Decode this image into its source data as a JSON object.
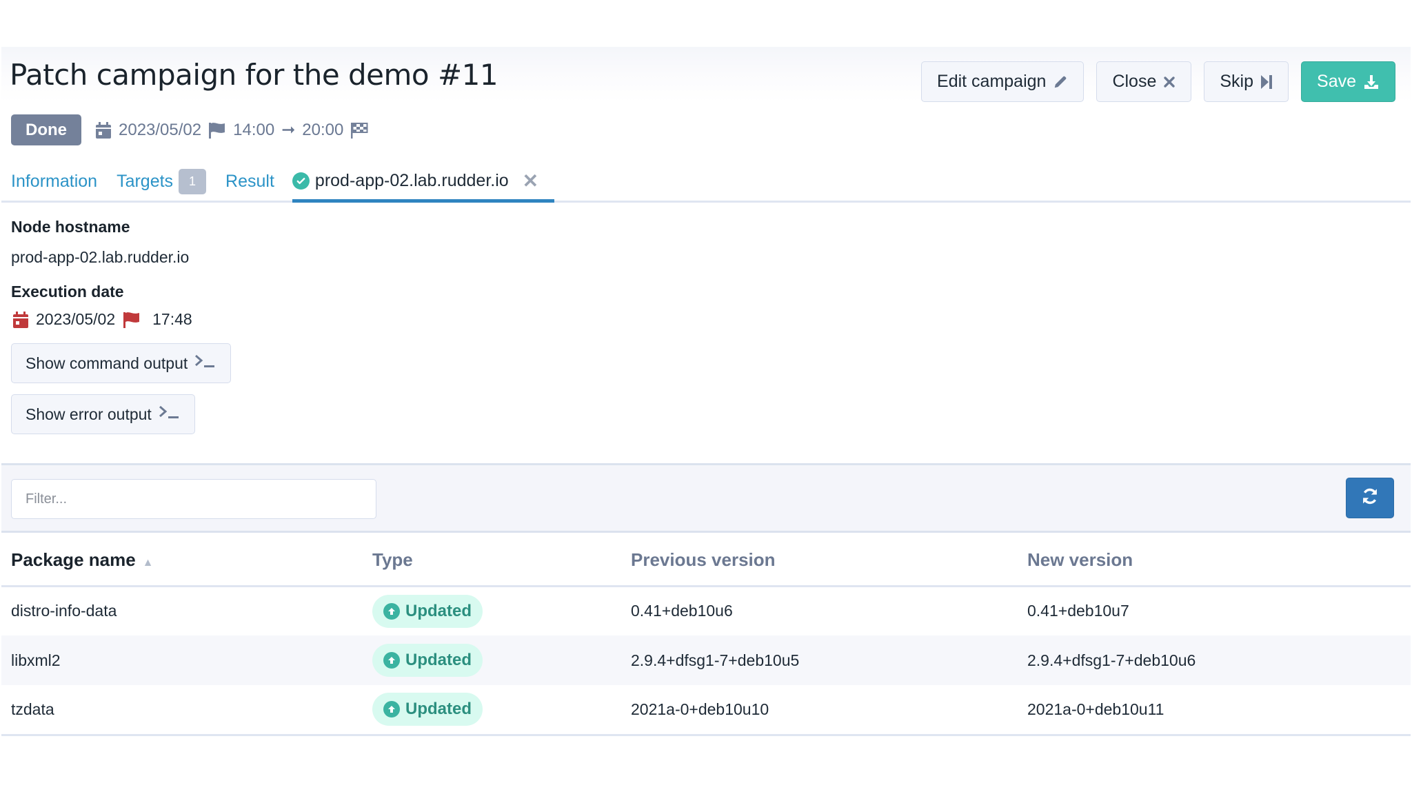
{
  "header": {
    "title": "Patch campaign for the demo #11",
    "status_badge": "Done",
    "date": "2023/05/02",
    "start_time": "14:00",
    "arrow": "➞",
    "end_time": "20:00"
  },
  "actions": {
    "edit_label": "Edit campaign",
    "close_label": "Close",
    "skip_label": "Skip",
    "save_label": "Save"
  },
  "tabs": [
    {
      "label": "Information"
    },
    {
      "label": "Targets",
      "count": "1"
    },
    {
      "label": "Result"
    },
    {
      "label": "prod-app-02.lab.rudder.io",
      "active": true,
      "closable": true
    }
  ],
  "details": {
    "hostname_label": "Node hostname",
    "hostname_value": "prod-app-02.lab.rudder.io",
    "execution_label": "Execution date",
    "execution_date": "2023/05/02",
    "execution_time": "17:48",
    "show_command_label": "Show command output",
    "show_error_label": "Show error output"
  },
  "filter": {
    "placeholder": "Filter...",
    "value": ""
  },
  "table": {
    "columns": [
      "Package name",
      "Type",
      "Previous version",
      "New version"
    ],
    "sorted_column": "Package name",
    "sort_direction": "ascending",
    "rows": [
      {
        "name": "distro-info-data",
        "type": "Updated",
        "previous": "0.41+deb10u6",
        "new": "0.41+deb10u7"
      },
      {
        "name": "libxml2",
        "type": "Updated",
        "previous": "2.9.4+dfsg1-7+deb10u5",
        "new": "2.9.4+dfsg1-7+deb10u6"
      },
      {
        "name": "tzdata",
        "type": "Updated",
        "previous": "2021a-0+deb10u10",
        "new": "2021a-0+deb10u11"
      }
    ]
  },
  "colors": {
    "accent_teal": "#40bfae",
    "link_blue": "#2b93c7",
    "refresh_blue": "#3177b8",
    "done_badge": "#74819a",
    "execution_red": "#c0393b",
    "updated_pill_bg": "#d8faf0"
  }
}
